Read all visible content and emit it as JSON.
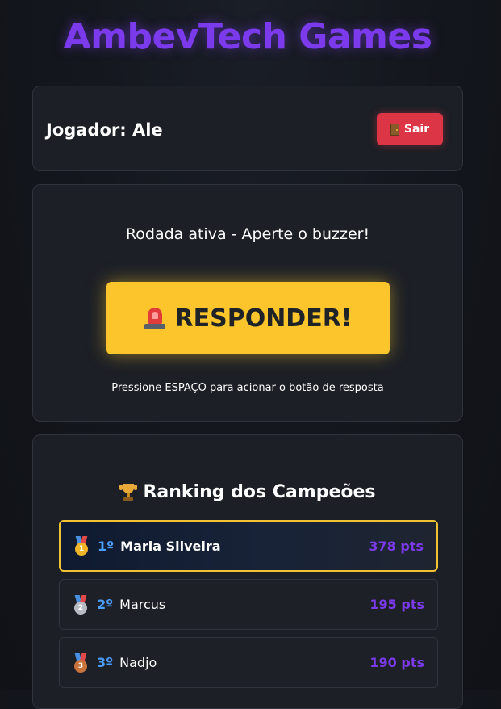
{
  "app": {
    "title": "AmbevTech Games"
  },
  "player": {
    "label": "Jogador: Ale",
    "logout_label": "Sair"
  },
  "round": {
    "status": "Rodada ativa - Aperte o buzzer!",
    "buzzer_label": "RESPONDER!",
    "hint": "Pressione ESPAÇO para acionar o botão de resposta"
  },
  "ranking": {
    "title": "Ranking dos Campeões",
    "items": [
      {
        "position": "1º",
        "name": "Maria Silveira",
        "points": "378 pts",
        "medal": "1"
      },
      {
        "position": "2º",
        "name": "Marcus",
        "points": "195 pts",
        "medal": "2"
      },
      {
        "position": "3º",
        "name": "Nadjo",
        "points": "190 pts",
        "medal": "3"
      }
    ]
  },
  "colors": {
    "accent": "#7c3aed",
    "buzzer": "#fbc52b",
    "danger": "#dc3545",
    "rank_position": "#4a9eff",
    "first_place_border": "#f1c232"
  },
  "icons": {
    "logout": "door-icon",
    "buzzer": "siren-icon",
    "ranking": "trophy-icon",
    "first": "gold-medal-icon",
    "second": "silver-medal-icon",
    "third": "bronze-medal-icon"
  }
}
